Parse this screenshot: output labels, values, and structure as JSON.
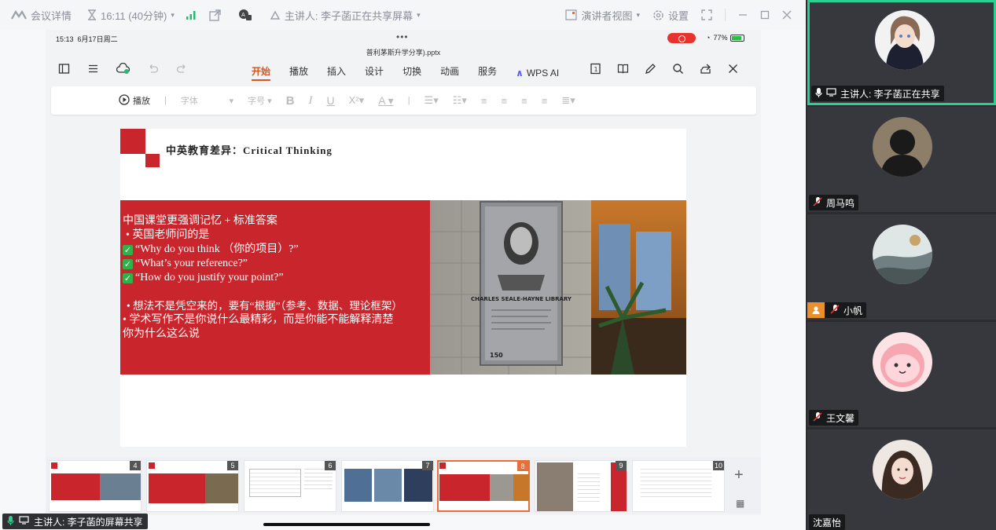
{
  "topbar": {
    "meeting_details": "会议详情",
    "timer": "16:11 (40分钟)",
    "presenter_status": "主讲人: 李子菡正在共享屏幕",
    "speaker_view": "演讲者视图",
    "settings": "设置"
  },
  "shared_screen": {
    "status_time": "15:13",
    "status_date": "6月17日周二",
    "battery": "77%",
    "file_name": "普利茅斯升学分享).pptx",
    "tabs": [
      "开始",
      "播放",
      "插入",
      "设计",
      "切换",
      "动画",
      "服务",
      "WPS AI"
    ],
    "active_tab": "开始",
    "ribbon": {
      "play": "播放",
      "font": "字体",
      "size": "字号"
    },
    "slide": {
      "title": "中英教育差异：Critical Thinking",
      "lines": [
        "中国课堂更强调记忆 + 标准答案",
        "• 英国老师问的是",
        "“Why do you think （你的项目）?”",
        "“What’s your reference?”",
        "“How do you justify your point?”",
        "• 想法不是凭空来的，要有“根据”（参考、数据、理论框架）",
        "• 学术写作不是你说什么最精彩，而是你能不能解释清楚",
        "你为什么这么说"
      ],
      "plaque_title": "CHARLES SEALE-HAYNE LIBRARY",
      "plaque_number": "150"
    },
    "thumbnails": [
      "4",
      "5",
      "6",
      "7",
      "8",
      "9",
      "10"
    ],
    "selected_thumbnail": "8"
  },
  "presenter_badge": "主讲人: 李子菡的屏幕共享",
  "participants": [
    {
      "name": "主讲人: 李子菡正在共享"
    },
    {
      "name": "周马鸣"
    },
    {
      "name": "小帆"
    },
    {
      "name": "王文馨"
    },
    {
      "name": "沈嘉怡"
    }
  ],
  "colors": {
    "accent_red": "#c8262c",
    "active_tab": "#d9541e",
    "active_speaker": "#2bcf8f"
  }
}
